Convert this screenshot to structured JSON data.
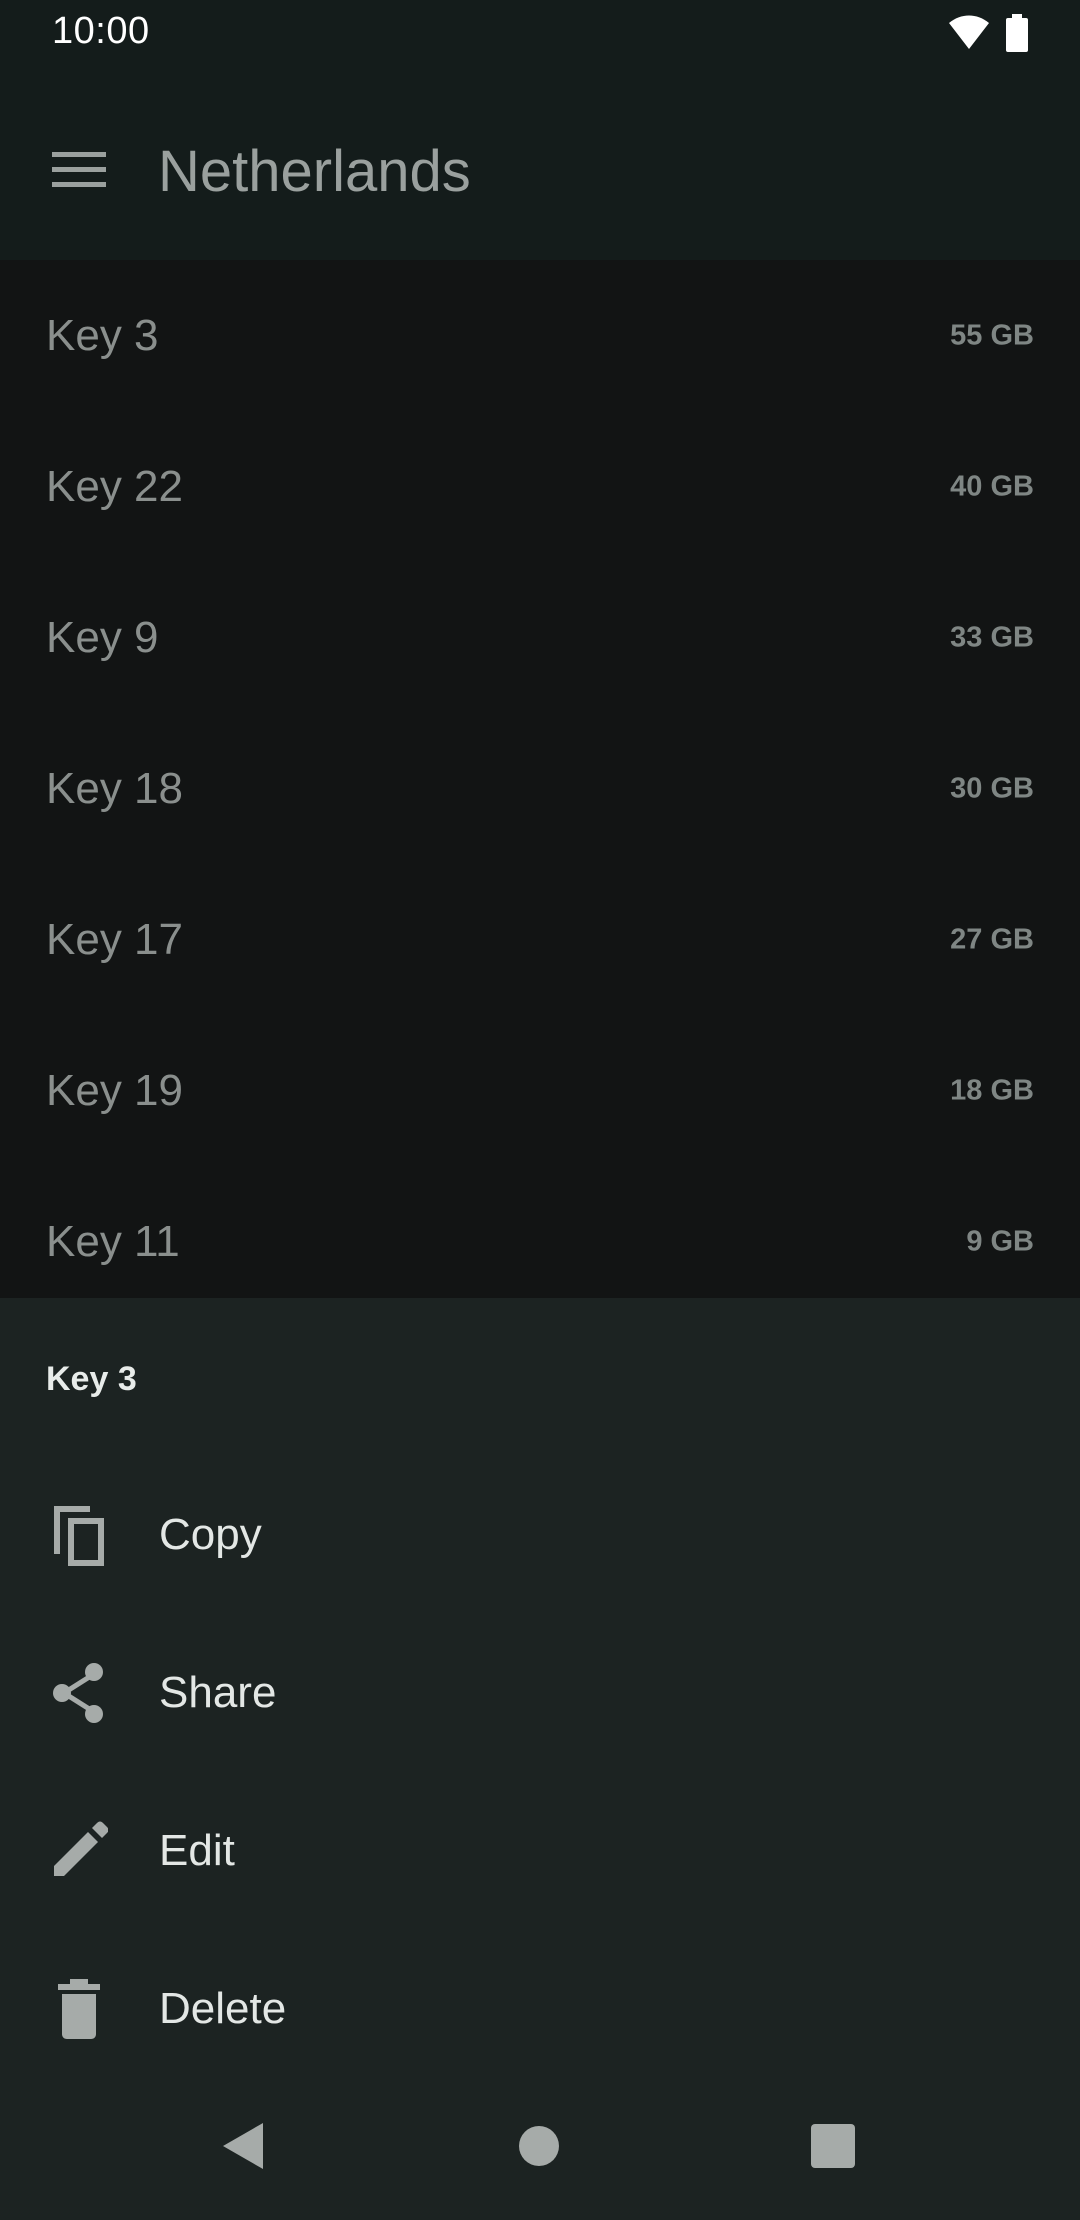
{
  "status_bar": {
    "time": "10:00",
    "icons": [
      "wifi-icon",
      "battery-icon"
    ]
  },
  "app_bar": {
    "title": "Netherlands",
    "nav_icon": "menu-icon"
  },
  "keys": [
    {
      "name": "Key 3",
      "size": "55 GB"
    },
    {
      "name": "Key 22",
      "size": "40 GB"
    },
    {
      "name": "Key 9",
      "size": "33 GB"
    },
    {
      "name": "Key 18",
      "size": "30 GB"
    },
    {
      "name": "Key 17",
      "size": "27 GB"
    },
    {
      "name": "Key 19",
      "size": "18 GB"
    },
    {
      "name": "Key 11",
      "size": "9 GB"
    }
  ],
  "bottom_sheet": {
    "title": "Key 3",
    "actions": [
      {
        "label": "Copy",
        "icon": "copy-icon"
      },
      {
        "label": "Share",
        "icon": "share-icon"
      },
      {
        "label": "Edit",
        "icon": "edit-icon"
      },
      {
        "label": "Delete",
        "icon": "delete-icon"
      }
    ]
  },
  "nav_bar": {
    "buttons": [
      "back-icon",
      "home-icon",
      "recents-icon"
    ]
  },
  "colors": {
    "app_bar_bg": "#141c1b",
    "list_bg": "#121414",
    "sheet_bg": "#1c2322",
    "icon_gray": "#a6aba9"
  }
}
